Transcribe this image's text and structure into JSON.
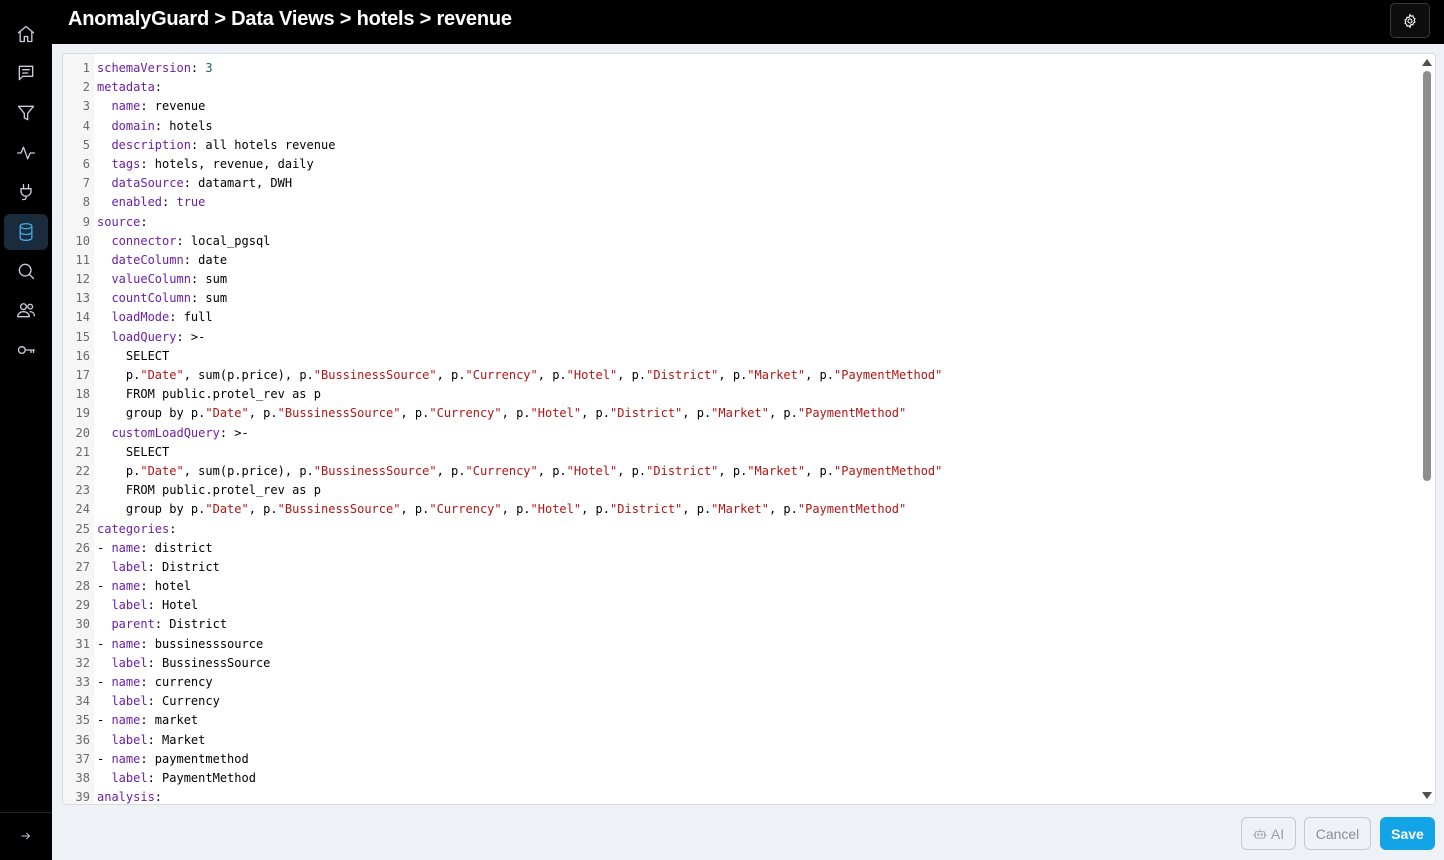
{
  "header": {
    "breadcrumb": "AnomalyGuard > Data Views > hotels > revenue",
    "settings_icon": "gear-icon"
  },
  "sidebar": {
    "items": [
      {
        "name": "home",
        "icon": "home-icon",
        "active": false
      },
      {
        "name": "messages",
        "icon": "message-icon",
        "active": false
      },
      {
        "name": "filters",
        "icon": "filter-icon",
        "active": false
      },
      {
        "name": "activity",
        "icon": "activity-icon",
        "active": false
      },
      {
        "name": "connectors",
        "icon": "plug-icon",
        "active": false
      },
      {
        "name": "data-views",
        "icon": "database-icon",
        "active": true
      },
      {
        "name": "search",
        "icon": "search-icon",
        "active": false
      },
      {
        "name": "users",
        "icon": "users-icon",
        "active": false
      },
      {
        "name": "keys",
        "icon": "key-icon",
        "active": false
      }
    ],
    "expand_icon": "arrow-right-icon"
  },
  "editor": {
    "lines": [
      [
        [
          "k",
          "schemaVersion"
        ],
        [
          "p",
          ": "
        ],
        [
          "n",
          "3"
        ]
      ],
      [
        [
          "k",
          "metadata"
        ],
        [
          "p",
          ":"
        ]
      ],
      [
        [
          "p",
          "  "
        ],
        [
          "k",
          "name"
        ],
        [
          "p",
          ": revenue"
        ]
      ],
      [
        [
          "p",
          "  "
        ],
        [
          "k",
          "domain"
        ],
        [
          "p",
          ": hotels"
        ]
      ],
      [
        [
          "p",
          "  "
        ],
        [
          "k",
          "description"
        ],
        [
          "p",
          ": all hotels revenue"
        ]
      ],
      [
        [
          "p",
          "  "
        ],
        [
          "k",
          "tags"
        ],
        [
          "p",
          ": hotels, revenue, daily"
        ]
      ],
      [
        [
          "p",
          "  "
        ],
        [
          "k",
          "dataSource"
        ],
        [
          "p",
          ": datamart, DWH"
        ]
      ],
      [
        [
          "p",
          "  "
        ],
        [
          "k",
          "enabled"
        ],
        [
          "p",
          ": "
        ],
        [
          "k",
          "true"
        ]
      ],
      [
        [
          "k",
          "source"
        ],
        [
          "p",
          ":"
        ]
      ],
      [
        [
          "p",
          "  "
        ],
        [
          "k",
          "connector"
        ],
        [
          "p",
          ": local_pgsql"
        ]
      ],
      [
        [
          "p",
          "  "
        ],
        [
          "k",
          "dateColumn"
        ],
        [
          "p",
          ": date"
        ]
      ],
      [
        [
          "p",
          "  "
        ],
        [
          "k",
          "valueColumn"
        ],
        [
          "p",
          ": sum"
        ]
      ],
      [
        [
          "p",
          "  "
        ],
        [
          "k",
          "countColumn"
        ],
        [
          "p",
          ": sum"
        ]
      ],
      [
        [
          "p",
          "  "
        ],
        [
          "k",
          "loadMode"
        ],
        [
          "p",
          ": full"
        ]
      ],
      [
        [
          "p",
          "  "
        ],
        [
          "k",
          "loadQuery"
        ],
        [
          "p",
          ": >-"
        ]
      ],
      [
        [
          "p",
          "    SELECT"
        ]
      ],
      [
        [
          "p",
          "    p."
        ],
        [
          "s",
          "\"Date\""
        ],
        [
          "p",
          ", sum(p.price), p."
        ],
        [
          "s",
          "\"BussinessSource\""
        ],
        [
          "p",
          ", p."
        ],
        [
          "s",
          "\"Currency\""
        ],
        [
          "p",
          ", p."
        ],
        [
          "s",
          "\"Hotel\""
        ],
        [
          "p",
          ", p."
        ],
        [
          "s",
          "\"District\""
        ],
        [
          "p",
          ", p."
        ],
        [
          "s",
          "\"Market\""
        ],
        [
          "p",
          ", p."
        ],
        [
          "s",
          "\"PaymentMethod\""
        ]
      ],
      [
        [
          "p",
          "    FROM public.protel_rev as p"
        ]
      ],
      [
        [
          "p",
          "    group by p."
        ],
        [
          "s",
          "\"Date\""
        ],
        [
          "p",
          ", p."
        ],
        [
          "s",
          "\"BussinessSource\""
        ],
        [
          "p",
          ", p."
        ],
        [
          "s",
          "\"Currency\""
        ],
        [
          "p",
          ", p."
        ],
        [
          "s",
          "\"Hotel\""
        ],
        [
          "p",
          ", p."
        ],
        [
          "s",
          "\"District\""
        ],
        [
          "p",
          ", p."
        ],
        [
          "s",
          "\"Market\""
        ],
        [
          "p",
          ", p."
        ],
        [
          "s",
          "\"PaymentMethod\""
        ]
      ],
      [
        [
          "p",
          "  "
        ],
        [
          "k",
          "customLoadQuery"
        ],
        [
          "p",
          ": >-"
        ]
      ],
      [
        [
          "p",
          "    SELECT"
        ]
      ],
      [
        [
          "p",
          "    p."
        ],
        [
          "s",
          "\"Date\""
        ],
        [
          "p",
          ", sum(p.price), p."
        ],
        [
          "s",
          "\"BussinessSource\""
        ],
        [
          "p",
          ", p."
        ],
        [
          "s",
          "\"Currency\""
        ],
        [
          "p",
          ", p."
        ],
        [
          "s",
          "\"Hotel\""
        ],
        [
          "p",
          ", p."
        ],
        [
          "s",
          "\"District\""
        ],
        [
          "p",
          ", p."
        ],
        [
          "s",
          "\"Market\""
        ],
        [
          "p",
          ", p."
        ],
        [
          "s",
          "\"PaymentMethod\""
        ]
      ],
      [
        [
          "p",
          "    FROM public.protel_rev as p"
        ]
      ],
      [
        [
          "p",
          "    group by p."
        ],
        [
          "s",
          "\"Date\""
        ],
        [
          "p",
          ", p."
        ],
        [
          "s",
          "\"BussinessSource\""
        ],
        [
          "p",
          ", p."
        ],
        [
          "s",
          "\"Currency\""
        ],
        [
          "p",
          ", p."
        ],
        [
          "s",
          "\"Hotel\""
        ],
        [
          "p",
          ", p."
        ],
        [
          "s",
          "\"District\""
        ],
        [
          "p",
          ", p."
        ],
        [
          "s",
          "\"Market\""
        ],
        [
          "p",
          ", p."
        ],
        [
          "s",
          "\"PaymentMethod\""
        ]
      ],
      [
        [
          "k",
          "categories"
        ],
        [
          "p",
          ":"
        ]
      ],
      [
        [
          "p",
          "- "
        ],
        [
          "k",
          "name"
        ],
        [
          "p",
          ": district"
        ]
      ],
      [
        [
          "p",
          "  "
        ],
        [
          "k",
          "label"
        ],
        [
          "p",
          ": District"
        ]
      ],
      [
        [
          "p",
          "- "
        ],
        [
          "k",
          "name"
        ],
        [
          "p",
          ": hotel"
        ]
      ],
      [
        [
          "p",
          "  "
        ],
        [
          "k",
          "label"
        ],
        [
          "p",
          ": Hotel"
        ]
      ],
      [
        [
          "p",
          "  "
        ],
        [
          "k",
          "parent"
        ],
        [
          "p",
          ": District"
        ]
      ],
      [
        [
          "p",
          "- "
        ],
        [
          "k",
          "name"
        ],
        [
          "p",
          ": bussinesssource"
        ]
      ],
      [
        [
          "p",
          "  "
        ],
        [
          "k",
          "label"
        ],
        [
          "p",
          ": BussinessSource"
        ]
      ],
      [
        [
          "p",
          "- "
        ],
        [
          "k",
          "name"
        ],
        [
          "p",
          ": currency"
        ]
      ],
      [
        [
          "p",
          "  "
        ],
        [
          "k",
          "label"
        ],
        [
          "p",
          ": Currency"
        ]
      ],
      [
        [
          "p",
          "- "
        ],
        [
          "k",
          "name"
        ],
        [
          "p",
          ": market"
        ]
      ],
      [
        [
          "p",
          "  "
        ],
        [
          "k",
          "label"
        ],
        [
          "p",
          ": Market"
        ]
      ],
      [
        [
          "p",
          "- "
        ],
        [
          "k",
          "name"
        ],
        [
          "p",
          ": paymentmethod"
        ]
      ],
      [
        [
          "p",
          "  "
        ],
        [
          "k",
          "label"
        ],
        [
          "p",
          ": PaymentMethod"
        ]
      ],
      [
        [
          "k",
          "analysis"
        ],
        [
          "p",
          ":"
        ]
      ]
    ]
  },
  "footer": {
    "ai_label": "AI",
    "cancel_label": "Cancel",
    "save_label": "Save"
  },
  "colors": {
    "accent": "#13a4e8",
    "yaml_key": "#6b1fa8",
    "yaml_string": "#b31414",
    "yaml_number": "#0b6e5f"
  }
}
